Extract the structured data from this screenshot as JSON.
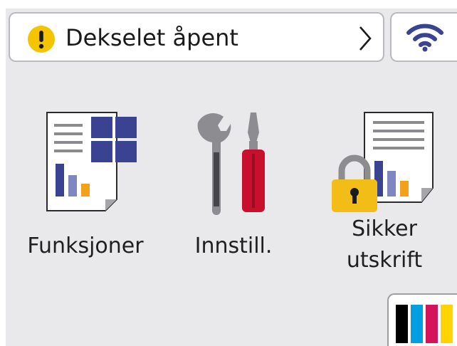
{
  "status": {
    "message": "Dekselet åpent",
    "icon": "warning-icon"
  },
  "wifi": {
    "icon": "wifi-icon"
  },
  "tiles": [
    {
      "label": "Funksjoner",
      "icon": "functions-icon"
    },
    {
      "label": "Innstill.",
      "icon": "settings-tools-icon"
    },
    {
      "label_line1": "Sikker",
      "label_line2": "utskrift",
      "icon": "secure-print-icon"
    }
  ],
  "ink": {
    "icon": "ink-toner-icon",
    "colors": [
      "#000000",
      "#00a0e0",
      "#d4145a",
      "#ffd400"
    ]
  },
  "colors": {
    "warning": "#f5c400",
    "accent_blue": "#3a4391",
    "bar_blue": "#5b64a8",
    "tool_red": "#c8102e",
    "tool_gray": "#8c8c91",
    "lock_yellow": "#f3bd17"
  }
}
